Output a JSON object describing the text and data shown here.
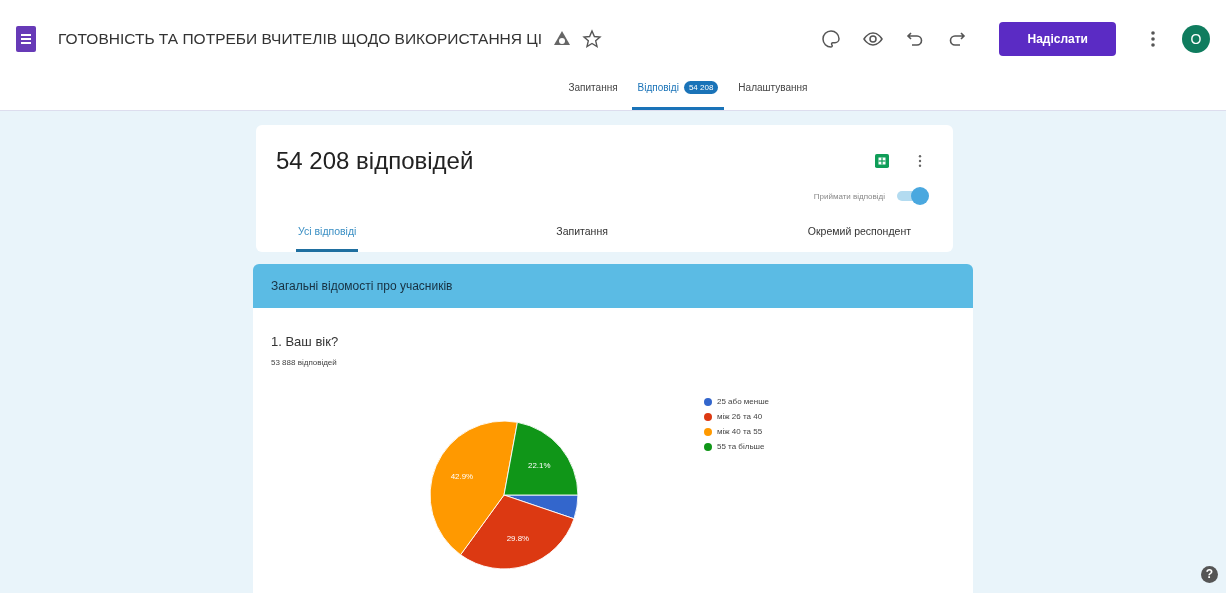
{
  "header": {
    "title": "ГОТОВНІСТЬ ТА ПОТРЕБИ ВЧИТЕЛІВ ЩОДО ВИКОРИСТАННЯ ЦІ",
    "send_button": "Надіслати",
    "avatar": "О"
  },
  "tabs": [
    {
      "label": "Запитання",
      "selected": false
    },
    {
      "label": "Відповіді",
      "badge": "54 208",
      "selected": true
    },
    {
      "label": "Налаштування",
      "selected": false
    }
  ],
  "summary": {
    "title": "54 208 відповідей",
    "accepting_label": "Приймати відповіді",
    "accepting": true
  },
  "view_tabs": [
    {
      "label": "Усі відповіді",
      "selected": true
    },
    {
      "label": "Запитання",
      "selected": false
    },
    {
      "label": "Окремий респондент",
      "selected": false
    }
  ],
  "section": {
    "title": "Загальні відомості про учасників"
  },
  "question": {
    "title": "1. Ваш вік?",
    "count": "53 888 відповідей",
    "chart_data": {
      "type": "pie",
      "categories": [
        "25 або менше",
        "між 26 та 40",
        "між 40 та 55",
        "55 та більше"
      ],
      "legend": "right",
      "series": [
        {
          "values": [
            5.2,
            29.8,
            42.9,
            22.1
          ]
        }
      ],
      "colors": [
        "#3366cc",
        "#dc3912",
        "#ff9900",
        "#109618"
      ],
      "value_labels": [
        null,
        "29.8%",
        "42.9%",
        "22.1%"
      ]
    }
  },
  "help_button": "?"
}
